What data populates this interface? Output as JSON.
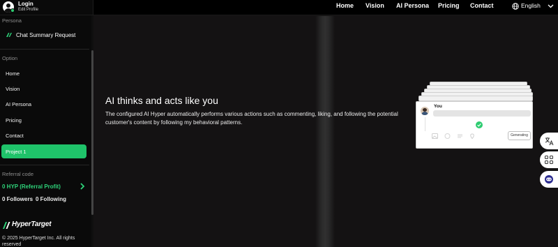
{
  "sidebar": {
    "login": "Login",
    "edit_profile": "Edit Profile",
    "persona_title": "Persona",
    "persona_item": "Chat Summary Request",
    "option_title": "Option",
    "items": [
      {
        "label": "Home"
      },
      {
        "label": "Vision"
      },
      {
        "label": "AI Persona"
      },
      {
        "label": "Pricing"
      },
      {
        "label": "Contact"
      },
      {
        "label": "Project 1",
        "active": true
      }
    ],
    "referral_title": "Referral code",
    "referral_value": "0 HYP (Referral Profit)",
    "followers": "0 Followers",
    "following": "0 Following",
    "logo_text": "HyperTarget",
    "copyright": "© 2025 HyperTarget Inc. All rights reserved"
  },
  "topnav": {
    "links": [
      "Home",
      "Vision",
      "AI Persona",
      "Pricing",
      "Contact"
    ],
    "language": "English"
  },
  "hero": {
    "title": "AI thinks and acts like you",
    "description": "The configured AI Hyper automatically performs various actions such as commenting, liking, and following the potential customer's content by following my behavioral patterns."
  },
  "illustration": {
    "you_label": "You",
    "generating_label": "Generating"
  },
  "colors": {
    "accent": "#1fc36a",
    "referral": "#2ed47a",
    "background": "#141213",
    "sidebar": "#0a0a0a"
  },
  "icons": [
    "user-avatar-icon",
    "leaf-logo-icon",
    "chevron-right-icon",
    "globe-icon",
    "chevron-down-icon",
    "check-circle-icon",
    "translate-icon",
    "grid-icon",
    "chat-bot-icon"
  ]
}
